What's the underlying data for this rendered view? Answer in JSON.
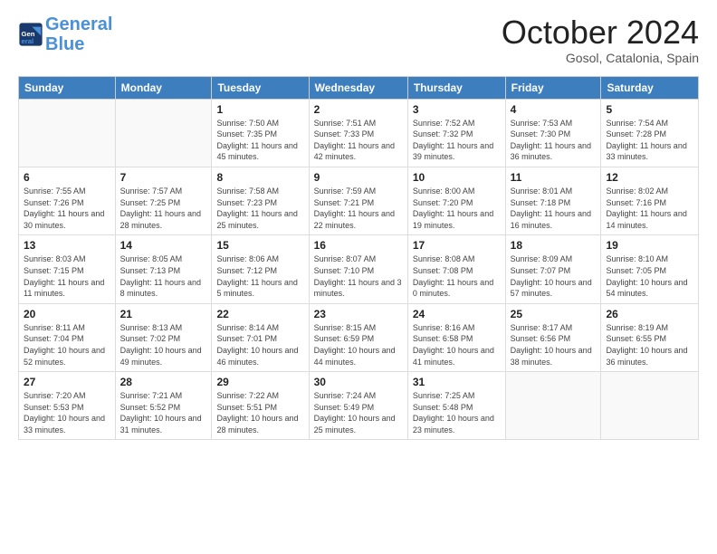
{
  "logo": {
    "line1": "General",
    "line2": "Blue"
  },
  "header": {
    "month": "October 2024",
    "location": "Gosol, Catalonia, Spain"
  },
  "weekdays": [
    "Sunday",
    "Monday",
    "Tuesday",
    "Wednesday",
    "Thursday",
    "Friday",
    "Saturday"
  ],
  "weeks": [
    [
      {
        "day": "",
        "info": ""
      },
      {
        "day": "",
        "info": ""
      },
      {
        "day": "1",
        "info": "Sunrise: 7:50 AM\nSunset: 7:35 PM\nDaylight: 11 hours and 45 minutes."
      },
      {
        "day": "2",
        "info": "Sunrise: 7:51 AM\nSunset: 7:33 PM\nDaylight: 11 hours and 42 minutes."
      },
      {
        "day": "3",
        "info": "Sunrise: 7:52 AM\nSunset: 7:32 PM\nDaylight: 11 hours and 39 minutes."
      },
      {
        "day": "4",
        "info": "Sunrise: 7:53 AM\nSunset: 7:30 PM\nDaylight: 11 hours and 36 minutes."
      },
      {
        "day": "5",
        "info": "Sunrise: 7:54 AM\nSunset: 7:28 PM\nDaylight: 11 hours and 33 minutes."
      }
    ],
    [
      {
        "day": "6",
        "info": "Sunrise: 7:55 AM\nSunset: 7:26 PM\nDaylight: 11 hours and 30 minutes."
      },
      {
        "day": "7",
        "info": "Sunrise: 7:57 AM\nSunset: 7:25 PM\nDaylight: 11 hours and 28 minutes."
      },
      {
        "day": "8",
        "info": "Sunrise: 7:58 AM\nSunset: 7:23 PM\nDaylight: 11 hours and 25 minutes."
      },
      {
        "day": "9",
        "info": "Sunrise: 7:59 AM\nSunset: 7:21 PM\nDaylight: 11 hours and 22 minutes."
      },
      {
        "day": "10",
        "info": "Sunrise: 8:00 AM\nSunset: 7:20 PM\nDaylight: 11 hours and 19 minutes."
      },
      {
        "day": "11",
        "info": "Sunrise: 8:01 AM\nSunset: 7:18 PM\nDaylight: 11 hours and 16 minutes."
      },
      {
        "day": "12",
        "info": "Sunrise: 8:02 AM\nSunset: 7:16 PM\nDaylight: 11 hours and 14 minutes."
      }
    ],
    [
      {
        "day": "13",
        "info": "Sunrise: 8:03 AM\nSunset: 7:15 PM\nDaylight: 11 hours and 11 minutes."
      },
      {
        "day": "14",
        "info": "Sunrise: 8:05 AM\nSunset: 7:13 PM\nDaylight: 11 hours and 8 minutes."
      },
      {
        "day": "15",
        "info": "Sunrise: 8:06 AM\nSunset: 7:12 PM\nDaylight: 11 hours and 5 minutes."
      },
      {
        "day": "16",
        "info": "Sunrise: 8:07 AM\nSunset: 7:10 PM\nDaylight: 11 hours and 3 minutes."
      },
      {
        "day": "17",
        "info": "Sunrise: 8:08 AM\nSunset: 7:08 PM\nDaylight: 11 hours and 0 minutes."
      },
      {
        "day": "18",
        "info": "Sunrise: 8:09 AM\nSunset: 7:07 PM\nDaylight: 10 hours and 57 minutes."
      },
      {
        "day": "19",
        "info": "Sunrise: 8:10 AM\nSunset: 7:05 PM\nDaylight: 10 hours and 54 minutes."
      }
    ],
    [
      {
        "day": "20",
        "info": "Sunrise: 8:11 AM\nSunset: 7:04 PM\nDaylight: 10 hours and 52 minutes."
      },
      {
        "day": "21",
        "info": "Sunrise: 8:13 AM\nSunset: 7:02 PM\nDaylight: 10 hours and 49 minutes."
      },
      {
        "day": "22",
        "info": "Sunrise: 8:14 AM\nSunset: 7:01 PM\nDaylight: 10 hours and 46 minutes."
      },
      {
        "day": "23",
        "info": "Sunrise: 8:15 AM\nSunset: 6:59 PM\nDaylight: 10 hours and 44 minutes."
      },
      {
        "day": "24",
        "info": "Sunrise: 8:16 AM\nSunset: 6:58 PM\nDaylight: 10 hours and 41 minutes."
      },
      {
        "day": "25",
        "info": "Sunrise: 8:17 AM\nSunset: 6:56 PM\nDaylight: 10 hours and 38 minutes."
      },
      {
        "day": "26",
        "info": "Sunrise: 8:19 AM\nSunset: 6:55 PM\nDaylight: 10 hours and 36 minutes."
      }
    ],
    [
      {
        "day": "27",
        "info": "Sunrise: 7:20 AM\nSunset: 5:53 PM\nDaylight: 10 hours and 33 minutes."
      },
      {
        "day": "28",
        "info": "Sunrise: 7:21 AM\nSunset: 5:52 PM\nDaylight: 10 hours and 31 minutes."
      },
      {
        "day": "29",
        "info": "Sunrise: 7:22 AM\nSunset: 5:51 PM\nDaylight: 10 hours and 28 minutes."
      },
      {
        "day": "30",
        "info": "Sunrise: 7:24 AM\nSunset: 5:49 PM\nDaylight: 10 hours and 25 minutes."
      },
      {
        "day": "31",
        "info": "Sunrise: 7:25 AM\nSunset: 5:48 PM\nDaylight: 10 hours and 23 minutes."
      },
      {
        "day": "",
        "info": ""
      },
      {
        "day": "",
        "info": ""
      }
    ]
  ]
}
